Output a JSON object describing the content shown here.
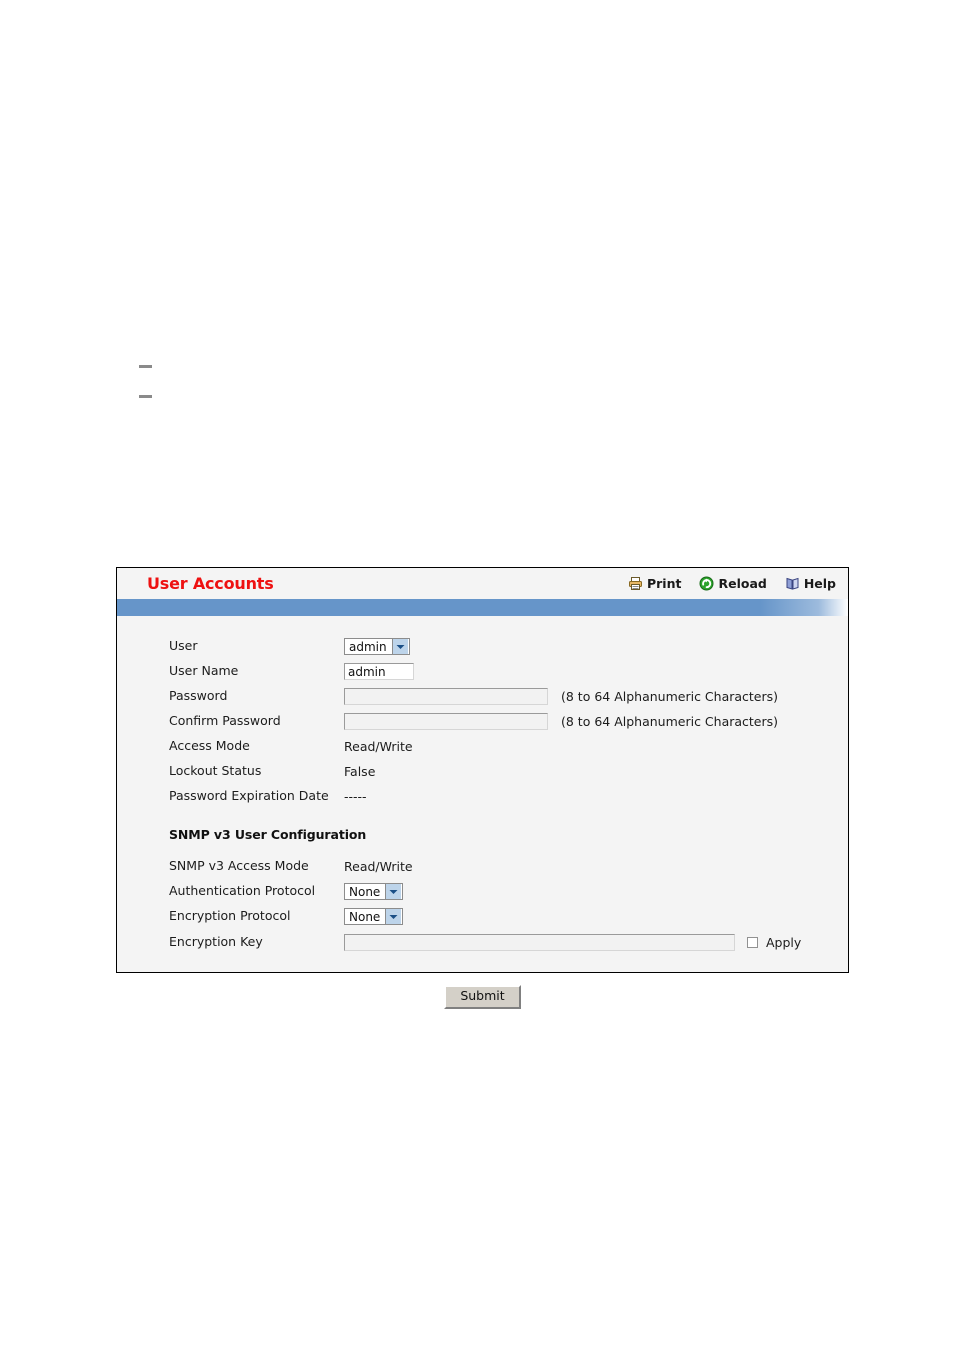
{
  "panel": {
    "title": "User Accounts",
    "toolbar": [
      {
        "label": "Print",
        "icon": "printer-icon"
      },
      {
        "label": "Reload",
        "icon": "reload-icon"
      },
      {
        "label": "Help",
        "icon": "help-book-icon"
      }
    ],
    "user_rows": [
      {
        "label": "User",
        "type": "select",
        "value": "admin"
      },
      {
        "label": "User Name",
        "type": "text",
        "value": "admin"
      },
      {
        "label": "Password",
        "type": "password",
        "value": "",
        "hint": "(8 to 64 Alphanumeric Characters)"
      },
      {
        "label": "Confirm Password",
        "type": "password",
        "value": "",
        "hint": "(8 to 64 Alphanumeric Characters)"
      },
      {
        "label": "Access Mode",
        "type": "static",
        "value": "Read/Write"
      },
      {
        "label": "Lockout Status",
        "type": "static",
        "value": "False"
      },
      {
        "label": "Password Expiration Date",
        "type": "static",
        "value": "-----"
      }
    ],
    "snmp": {
      "heading": "SNMP v3 User Configuration",
      "rows": [
        {
          "label": "SNMP v3 Access Mode",
          "type": "static",
          "value": "Read/Write"
        },
        {
          "label": "Authentication Protocol",
          "type": "select",
          "value": "None"
        },
        {
          "label": "Encryption Protocol",
          "type": "select",
          "value": "None"
        },
        {
          "label": "Encryption Key",
          "type": "text",
          "value": ""
        }
      ],
      "apply_label": "Apply",
      "apply_checked": false
    },
    "submit_label": "Submit",
    "colors": {
      "title_red": "#ee1111",
      "bar_blue": "#6695c9",
      "body_gray": "#f4f4f4",
      "button_face": "#d4d0c8"
    }
  }
}
